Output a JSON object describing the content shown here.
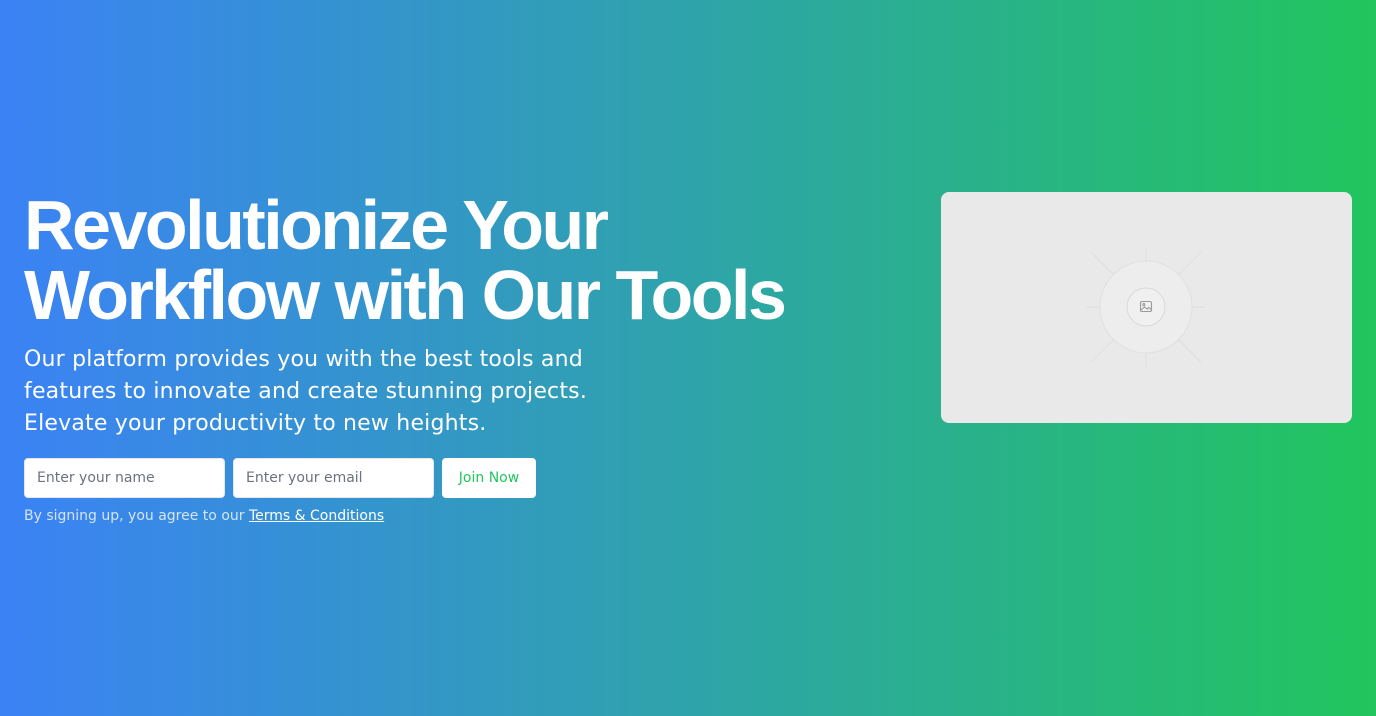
{
  "hero": {
    "headline_line1": "Revolutionize Your",
    "headline_line2": "Workflow with Our Tools",
    "subtext": "Our platform provides you with the best tools and features to innovate and create stunning projects. Elevate your productivity to new heights."
  },
  "form": {
    "name_placeholder": "Enter your name",
    "email_placeholder": "Enter your email",
    "submit_label": "Join Now",
    "terms_prefix": "By signing up, you agree to our ",
    "terms_link": "Terms & Conditions"
  },
  "media": {
    "icon": "image-icon"
  },
  "colors": {
    "gradient_start": "#3b82f6",
    "gradient_end": "#22c55e",
    "button_text": "#22c55e",
    "placeholder_bg": "#e9e9e9"
  }
}
